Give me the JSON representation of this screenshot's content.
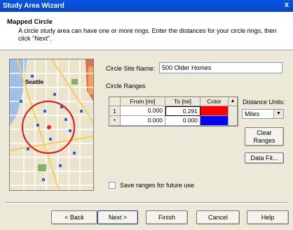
{
  "window": {
    "title": "Study Area Wizard",
    "close": "x"
  },
  "header": {
    "title": "Mapped Circle",
    "description": "A circle study area can have one or more rings.  Enter the distances for your circle rings, then click \"Next\"."
  },
  "map": {
    "city_label": "Seattle",
    "icon": "map-icon"
  },
  "site": {
    "label": "Circle Site Name:",
    "value": "500 Older Homes"
  },
  "ranges": {
    "label": "Circle Ranges",
    "columns": [
      "From [mi]",
      "To [mi]",
      "Color"
    ],
    "rows": [
      {
        "marker": "1",
        "from": "0.000",
        "to": "0.291",
        "color": "#ff0000"
      },
      {
        "marker": "*",
        "from": "0.000",
        "to": "0.000",
        "color": "#0000ff"
      }
    ],
    "scroll_up": "▲"
  },
  "units": {
    "label": "Distance Units:",
    "value": "Miles",
    "arrow": "▼"
  },
  "buttons": {
    "clear_line1": "Clear",
    "clear_line2": "Ranges",
    "data_fit": "Data Fit...",
    "back": "< Back",
    "next": "Next >",
    "finish": "Finish",
    "cancel": "Cancel",
    "help": "Help"
  },
  "save_ranges": {
    "label": "Save ranges for future use",
    "checked": false
  }
}
